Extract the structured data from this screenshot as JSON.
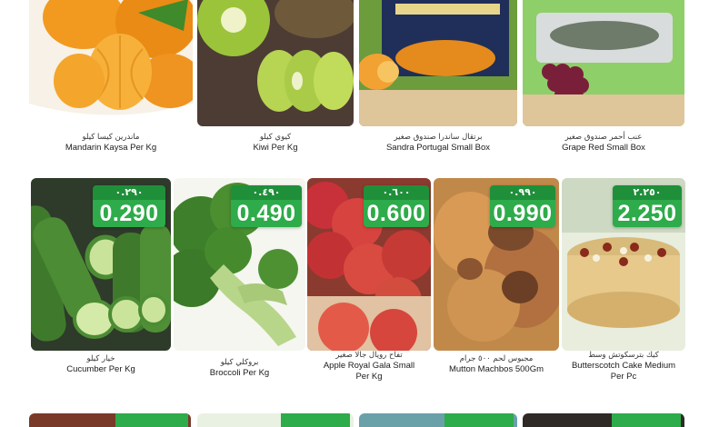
{
  "products": [
    {
      "name_en": "Mandarin Kaysa Per Kg",
      "name_ar": "ماندرين كيسا كيلو"
    },
    {
      "name_en": "Kiwi Per Kg",
      "name_ar": "كيوي كيلو"
    },
    {
      "name_en": "Sandra Portugal Small Box",
      "name_ar": "برتقال ساندرا صندوق صغير"
    },
    {
      "name_en": "Grape Red Small Box",
      "name_ar": "عنب أحمر صندوق صغير"
    },
    {
      "name_en": "Cucumber Per Kg",
      "name_ar": "خيار كيلو",
      "price": "0.290",
      "old_price": "٠.٢٩٠"
    },
    {
      "name_en": "Broccoli Per Kg",
      "name_ar": "بروكلي كيلو",
      "price": "0.490",
      "old_price": "٠.٤٩٠"
    },
    {
      "name_en": "Apple Royal Gala Small",
      "name_ar": "تفاح رويال جالا صغير",
      "name_en2": "Per Kg",
      "price": "0.600",
      "old_price": "٠.٦٠٠"
    },
    {
      "name_en": "Mutton Machbos 500Gm",
      "name_ar": "مجبوس لحم ٥٠٠ جرام",
      "price": "0.990",
      "old_price": "٠.٩٩٠"
    },
    {
      "name_en": "Butterscotch Cake Medium",
      "name_ar": "كيك بترسكوتش وسط",
      "name_en2": "Per Pc",
      "price": "2.250",
      "old_price": "٢.٢٥٠"
    }
  ],
  "colors": {
    "tag_dark": "#1f8f3a",
    "tag_light": "#2eab4a"
  }
}
